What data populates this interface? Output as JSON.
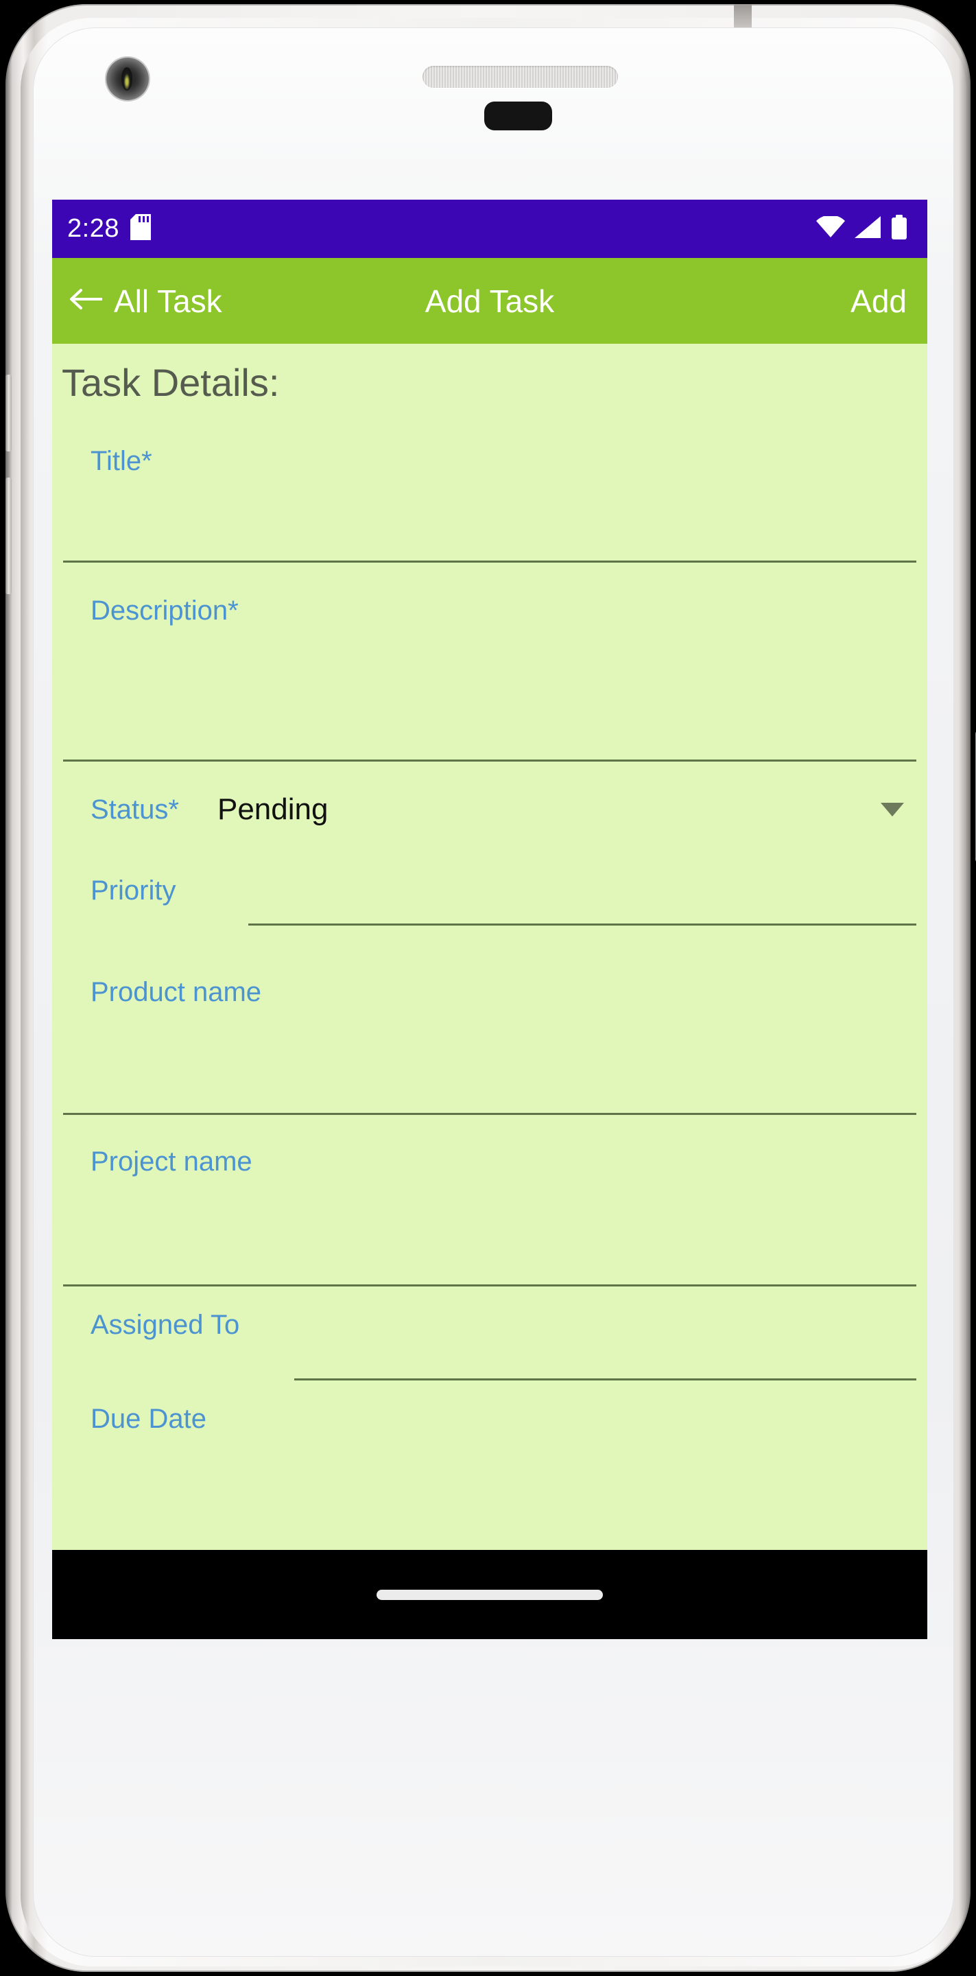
{
  "device": {
    "camera_icon": "camera-lens",
    "speaker_icon": "earpiece-speaker",
    "sensor_icon": "proximity-sensor"
  },
  "status_bar": {
    "time": "2:28",
    "sd_icon": "sd-card-icon",
    "wifi_icon": "wifi-icon",
    "signal_icon": "cellular-signal-icon",
    "battery_icon": "battery-full-icon",
    "background": "#3c06b4"
  },
  "app_bar": {
    "back_icon": "back-arrow-icon",
    "back_label": "All Task",
    "title": "Add Task",
    "action_label": "Add",
    "background": "#8cc62b"
  },
  "content": {
    "heading": "Task Details:",
    "background": "#e1f6b9",
    "label_color": "#4b93d1",
    "fields": [
      {
        "label": "Title*",
        "value": "",
        "placeholder": ""
      },
      {
        "label": "Description*",
        "value": "",
        "placeholder": ""
      },
      {
        "label": "Status*",
        "value": "Pending",
        "dropdown_icon": "chevron-down-icon"
      },
      {
        "label": "Priority",
        "value": "",
        "placeholder": ""
      },
      {
        "label": "Product name",
        "value": "",
        "placeholder": ""
      },
      {
        "label": "Project name",
        "value": "",
        "placeholder": ""
      },
      {
        "label": "Assigned To",
        "value": "",
        "placeholder": ""
      },
      {
        "label": "Due Date",
        "value": "",
        "placeholder": ""
      }
    ]
  },
  "nav_bar": {
    "gesture_pill_icon": "home-gesture-pill",
    "background": "#000000"
  }
}
